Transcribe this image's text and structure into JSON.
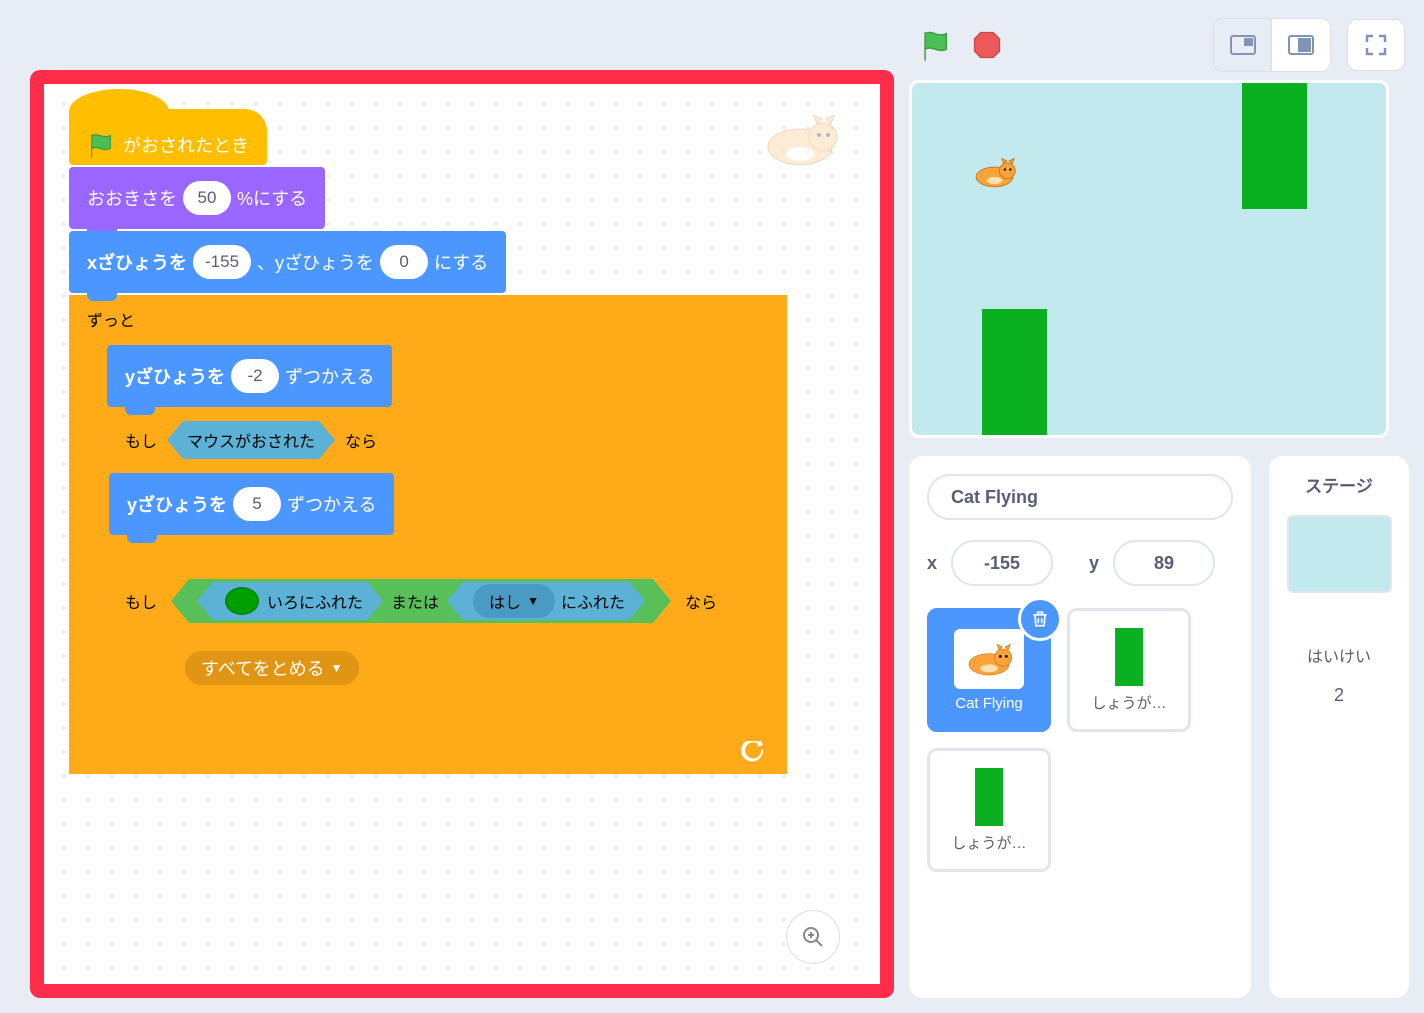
{
  "blocks": {
    "hat": "がおされたとき",
    "setSize": {
      "prefix": "おおきさを",
      "value": "50",
      "suffix": "%にする"
    },
    "goto": {
      "p1": "xざひょうを",
      "x": "-155",
      "p2": "、yざひょうを",
      "y": "0",
      "p3": "にする"
    },
    "forever": "ずっと",
    "changeY1": {
      "p1": "yざひょうを",
      "v": "-2",
      "p2": "ずつかえる"
    },
    "if1": {
      "p1": "もし",
      "cond": "マウスがおされた",
      "p2": "なら"
    },
    "changeY2": {
      "p1": "yざひょうを",
      "v": "5",
      "p2": "ずつかえる"
    },
    "if2": {
      "p1": "もし",
      "touchColor": "いろにふれた",
      "or": "または",
      "touchEdge": {
        "dropdown": "はし",
        "suffix": "にふれた"
      },
      "p2": "なら"
    },
    "stopAll": "すべてをとめる"
  },
  "colors": {
    "touching": "#00a000"
  },
  "sprite": {
    "nameLabel": "Cat Flying",
    "xLabel": "x",
    "yLabel": "y",
    "x": "-155",
    "y": "89"
  },
  "sprites": {
    "tile1": "Cat Flying",
    "tile2": "しょうが…",
    "tile3": "しょうが…"
  },
  "stagePanel": {
    "title": "ステージ",
    "label": "はいけい",
    "count": "2"
  }
}
